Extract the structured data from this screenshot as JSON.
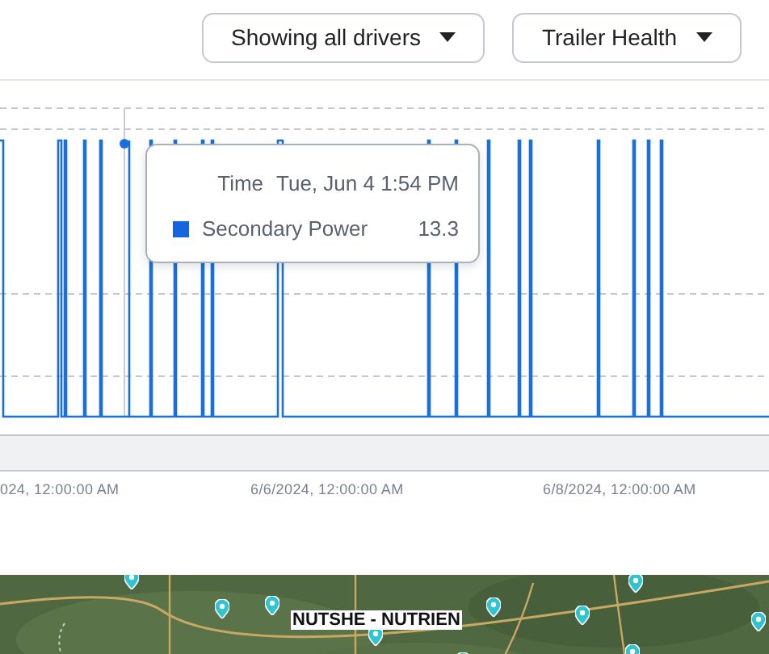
{
  "toolbar": {
    "dropdowns": [
      {
        "label": "Showing all drivers"
      },
      {
        "label": "Trailer Health"
      }
    ]
  },
  "chart": {
    "tooltip": {
      "time_label": "Time",
      "time": "Tue, Jun 4 1:54 PM",
      "series": [
        {
          "name": "Secondary Power",
          "value": "13.3"
        }
      ]
    },
    "x_axis_labels": [
      "024, 12:00:00 AM",
      "6/6/2024, 12:00:00 AM",
      "6/8/2024, 12:00:00 AM"
    ]
  },
  "map": {
    "kind": "picture",
    "label": "NUTSHE - NUTRIEN"
  }
}
